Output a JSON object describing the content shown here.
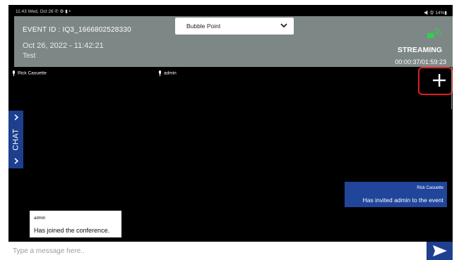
{
  "status_bar": {
    "left_text": "11:43  Wed, Oct 26  ✆ ⚙ ▮ •",
    "right_text": "◀ 令 14%▮"
  },
  "event": {
    "id_text": "EVENT ID : IQ3_1666802528330",
    "date_text": "Oct 26, 2022 - 11:42:21",
    "name_text": "Test"
  },
  "location_dropdown": {
    "selected": "Bubble Point"
  },
  "stream": {
    "status_label": "STREAMING",
    "timer": "00:00:37/01:59:23",
    "indicator_color": "#2fd04a"
  },
  "participants": [
    {
      "name": "Rick Caouette"
    },
    {
      "name": "admin"
    }
  ],
  "chat_tab": {
    "label": "CHAT"
  },
  "messages": [
    {
      "sender": "Rick Caouette",
      "text": "Has invited admin to the event"
    },
    {
      "sender": "admin",
      "text": "Has joined the conference."
    }
  ],
  "composer": {
    "placeholder": "Type a message here.."
  },
  "colors": {
    "accent_blue": "#1f3f8f",
    "highlight_red": "#e0201f"
  }
}
